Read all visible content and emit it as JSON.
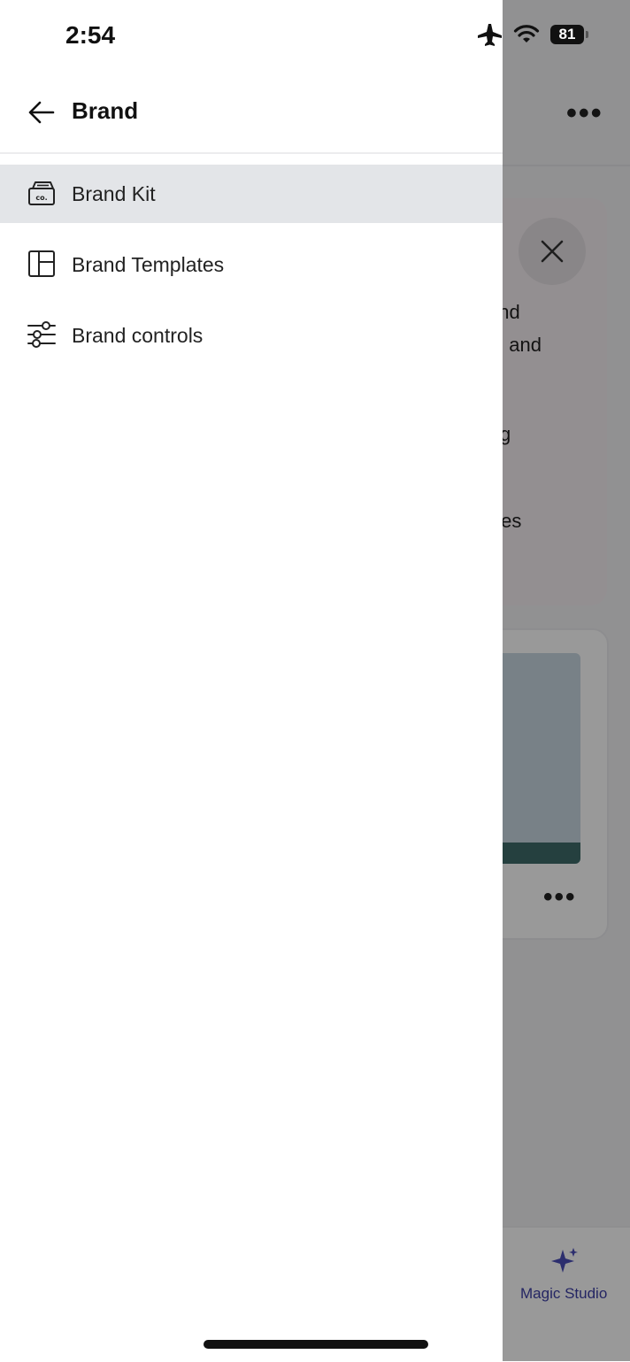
{
  "status_bar": {
    "time": "2:54",
    "battery": "81"
  },
  "drawer": {
    "title": "Brand",
    "items": [
      {
        "label": "Brand Kit",
        "icon": "brand-kit-icon",
        "selected": true
      },
      {
        "label": "Brand Templates",
        "icon": "template-layout-icon",
        "selected": false
      },
      {
        "label": "Brand controls",
        "icon": "sliders-icon",
        "selected": false
      }
    ]
  },
  "background": {
    "card_text_fragments": [
      "and",
      "s, and",
      "g",
      "tes"
    ],
    "tab_label": "Magic Studio",
    "colors": {
      "scrim": "#000000",
      "selected_row": "#e3e5e8",
      "accent": "#3c3fa5"
    }
  }
}
